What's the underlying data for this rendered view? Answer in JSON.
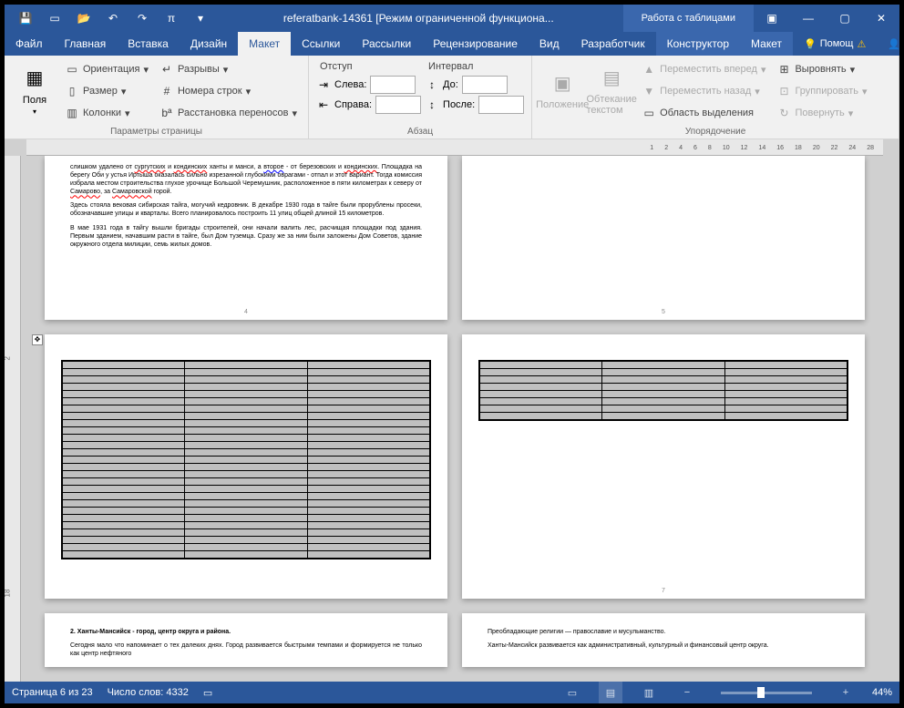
{
  "title": "referatbank-14361 [Режим ограниченной функциона...",
  "tabletools_title": "Работа с таблицами",
  "tabs": {
    "file": "Файл",
    "home": "Главная",
    "insert": "Вставка",
    "design": "Дизайн",
    "layout": "Макет",
    "references": "Ссылки",
    "mailings": "Рассылки",
    "review": "Рецензирование",
    "view": "Вид",
    "developer": "Разработчик",
    "table_design": "Конструктор",
    "table_layout": "Макет",
    "help": "Помощ",
    "share": "Общий доступ"
  },
  "ribbon": {
    "page_setup": {
      "margins": "Поля",
      "orientation": "Ориентация",
      "size": "Размер",
      "columns": "Колонки",
      "breaks": "Разрывы",
      "line_numbers": "Номера строк",
      "hyphenation": "Расстановка переносов",
      "label": "Параметры страницы"
    },
    "paragraph": {
      "indent_header": "Отступ",
      "left": "Слева:",
      "right": "Справа:",
      "spacing_header": "Интервал",
      "before": "До:",
      "after": "После:",
      "left_val": "",
      "right_val": "",
      "before_val": "",
      "after_val": "",
      "label": "Абзац"
    },
    "arrange": {
      "position": "Положение",
      "wrap": "Обтекание текстом",
      "bring_forward": "Переместить вперед",
      "send_backward": "Переместить назад",
      "selection_pane": "Область выделения",
      "align": "Выровнять",
      "group": "Группировать",
      "rotate": "Повернуть",
      "label": "Упорядочение"
    }
  },
  "document": {
    "page4_p1a": "слишком удалено от ",
    "page4_red1": "сургутских",
    "page4_p1b": " и ",
    "page4_red2": "кондинских",
    "page4_p1c": " ханты и манси, а ",
    "page4_blue1": "второе",
    "page4_p1d": " - от березовских и ",
    "page4_red3": "кондинских",
    "page4_p1e": ". Площадка на берегу Оби у устья Иртыша оказалась сильно изрезанной глубокими оврагами - отпал и этот вариант. Тогда комиссия избрала местом строительства глухое урочище Большой Черемушник, расположенное в пяти километрах к северу от ",
    "page4_red4": "Самарово",
    "page4_p1f": ", за ",
    "page4_red5": "Самаровской",
    "page4_p1g": " горой.",
    "page4_p2": "Здесь стояла вековая сибирская тайга, могучий кедровник. В декабре 1930 года в тайге были прорублены просеки, обозначавшие улицы и кварталы. Всего планировалось построить 11 улиц общей длиной 15 километров.",
    "page4_p3": "В мае 1931 года в тайгу вышли бригады строителей, они начали валить лес, расчищая площадки под здания. Первым зданием, начавшим расти в тайге, был Дом туземца. Сразу же за ним были заложены Дом Советов, здание окружного отдела милиции, семь жилых домов.",
    "page8_h": "2. Ханты-Мансийск - город, центр округа и района.",
    "page8_p": "Сегодня мало что напоминает о тех далеких днях. Город развивается быстрыми темпами и формируется не только как центр нефтяного",
    "page9_p1": "Преобладающие религии — православие и мусульманство.",
    "page9_p2": "Ханты-Мансийск развивается как административный, культурный и финансовый центр округа.",
    "pgnum4": "4",
    "pgnum5": "5",
    "pgnum7": "7"
  },
  "status": {
    "page": "Страница 6 из 23",
    "words": "Число слов: 4332",
    "zoom": "44%"
  },
  "ruler_ticks": [
    "1",
    "2",
    "4",
    "6",
    "8",
    "10",
    "12",
    "14",
    "16",
    "18",
    "20",
    "22",
    "24",
    "28"
  ]
}
